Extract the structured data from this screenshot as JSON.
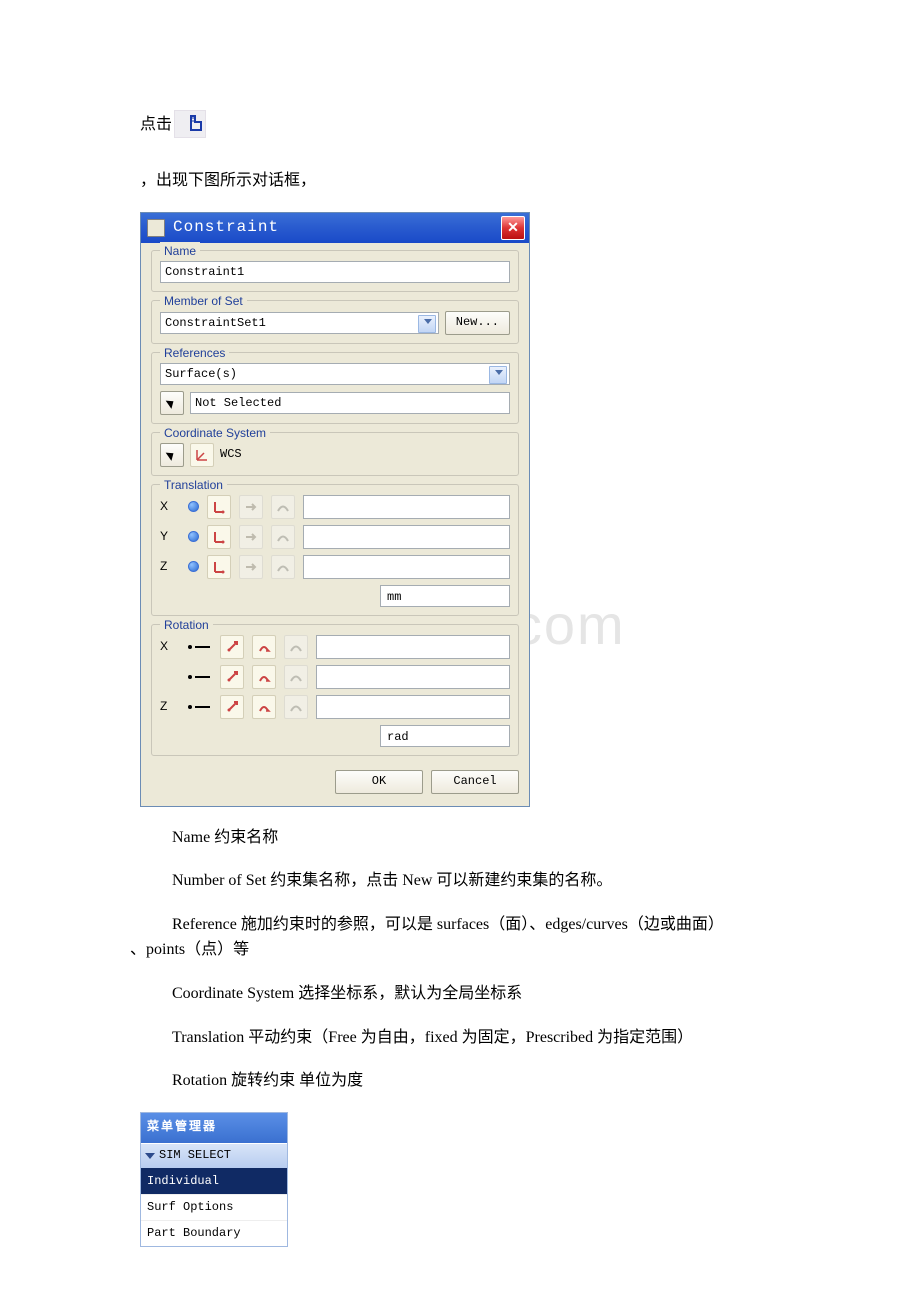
{
  "intro": {
    "click_prefix": "点击",
    "desc_line": "，出现下图所示对话框，"
  },
  "dialog": {
    "title": "Constraint",
    "groups": {
      "name": {
        "title": "Name",
        "value": "Constraint1"
      },
      "member_of_set": {
        "title": "Member of Set",
        "value": "ConstraintSet1",
        "new_btn": "New..."
      },
      "references": {
        "title": "References",
        "type_value": "Surface(s)",
        "status": "Not Selected"
      },
      "coord_sys": {
        "title": "Coordinate System",
        "value": "WCS"
      },
      "translation": {
        "title": "Translation",
        "rows": [
          {
            "axis": "X"
          },
          {
            "axis": "Y"
          },
          {
            "axis": "Z"
          }
        ],
        "unit": "mm"
      },
      "rotation": {
        "title": "Rotation",
        "rows": [
          {
            "axis": "X"
          },
          {
            "axis": ""
          },
          {
            "axis": "Z"
          }
        ],
        "unit": "rad"
      }
    },
    "buttons": {
      "ok": "OK",
      "cancel": "Cancel"
    }
  },
  "explain": {
    "p1": "Name 约束名称",
    "p2": "Number of Set 约束集名称，点击 New 可以新建约束集的名称。",
    "p3a": "Reference 施加约束时的参照，可以是 surfaces（面）、edges/curves（边或曲面）",
    "p3b": "、points（点）等",
    "p4": "Coordinate System 选择坐标系，默认为全局坐标系",
    "p5": "Translation  平动约束（Free 为自由，fixed 为固定，Prescribed 为指定范围）",
    "p6": "Rotation 旋转约束 单位为度"
  },
  "menu": {
    "title": "菜单管理器",
    "header": "SIM SELECT",
    "items": [
      {
        "label": "Individual",
        "selected": true
      },
      {
        "label": "Surf Options",
        "selected": false
      },
      {
        "label": "Part Boundary",
        "selected": false
      }
    ]
  },
  "watermark": "w.bdocx.com"
}
